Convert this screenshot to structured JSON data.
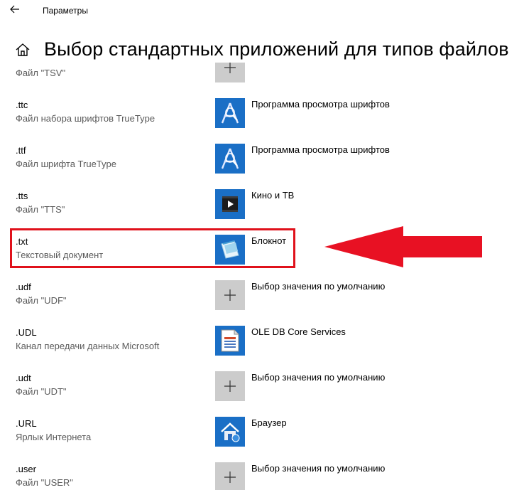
{
  "window": {
    "title": "Параметры",
    "back_icon": "back-arrow-icon"
  },
  "header": {
    "home_icon": "home-icon",
    "title": "Выбор стандартных приложений для типов файлов"
  },
  "rows": [
    {
      "ext": "",
      "desc": "Файл \"TSV\"",
      "app": "",
      "icon": "plus-icon"
    },
    {
      "ext": ".ttc",
      "desc": "Файл набора шрифтов TrueType",
      "app": "Программа просмотра шрифтов",
      "icon": "font-viewer-icon"
    },
    {
      "ext": ".ttf",
      "desc": "Файл шрифта TrueType",
      "app": "Программа просмотра шрифтов",
      "icon": "font-viewer-icon"
    },
    {
      "ext": ".tts",
      "desc": "Файл \"TTS\"",
      "app": "Кино и ТВ",
      "icon": "movies-tv-icon"
    },
    {
      "ext": ".txt",
      "desc": "Текстовый документ",
      "app": "Блокнот",
      "icon": "notepad-icon"
    },
    {
      "ext": ".udf",
      "desc": "Файл \"UDF\"",
      "app": "Выбор значения по умолчанию",
      "icon": "plus-icon"
    },
    {
      "ext": ".UDL",
      "desc": "Канал передачи данных Microsoft",
      "app": "OLE DB Core Services",
      "icon": "ole-db-icon"
    },
    {
      "ext": ".udt",
      "desc": "Файл \"UDT\"",
      "app": "Выбор значения по умолчанию",
      "icon": "plus-icon"
    },
    {
      "ext": ".URL",
      "desc": "Ярлык Интернета",
      "app": "Браузер",
      "icon": "browser-icon"
    },
    {
      "ext": ".user",
      "desc": "Файл \"USER\"",
      "app": "Выбор значения по умолчанию",
      "icon": "plus-icon"
    }
  ],
  "annotation": {
    "highlight_color": "#e0111b",
    "arrow_color": "#e81123"
  }
}
